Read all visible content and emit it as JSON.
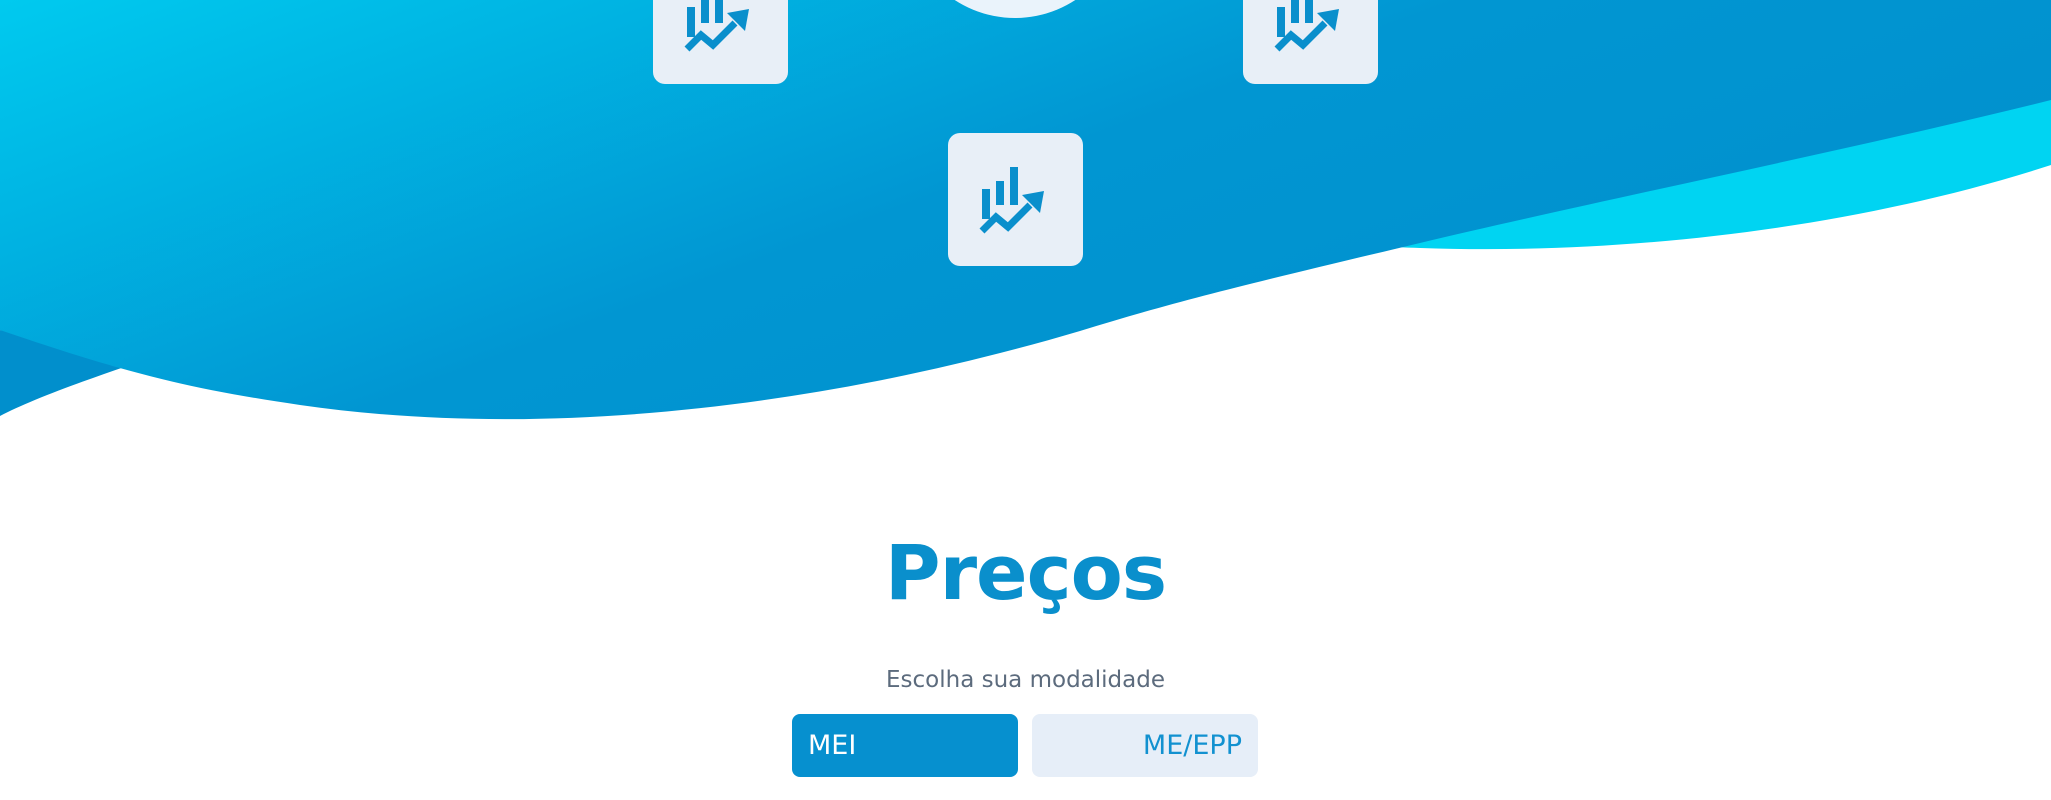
{
  "hero": {
    "colors": {
      "gradient_start": "#00c8ee",
      "gradient_end": "#0192cf",
      "accent_wave": "#00d4f2",
      "tile_background": "#e8eff7",
      "icon": "#0a8fcc"
    },
    "feature_tiles": [
      {
        "icon": "bar-chart-growth-icon"
      },
      {
        "icon": "bar-chart-growth-icon"
      },
      {
        "icon": "bar-chart-growth-icon"
      }
    ]
  },
  "pricing": {
    "title": "Preços",
    "subtitle": "Escolha sua modalidade",
    "options": [
      {
        "label": "MEI",
        "selected": true
      },
      {
        "label": "ME/EPP",
        "selected": false
      }
    ],
    "colors": {
      "title": "#0a8fcc",
      "subtitle": "#5c6b7d",
      "selected_bg": "#0690cf",
      "selected_text": "#ffffff",
      "unselected_bg": "#e6eef8",
      "unselected_text": "#1291d0"
    }
  }
}
